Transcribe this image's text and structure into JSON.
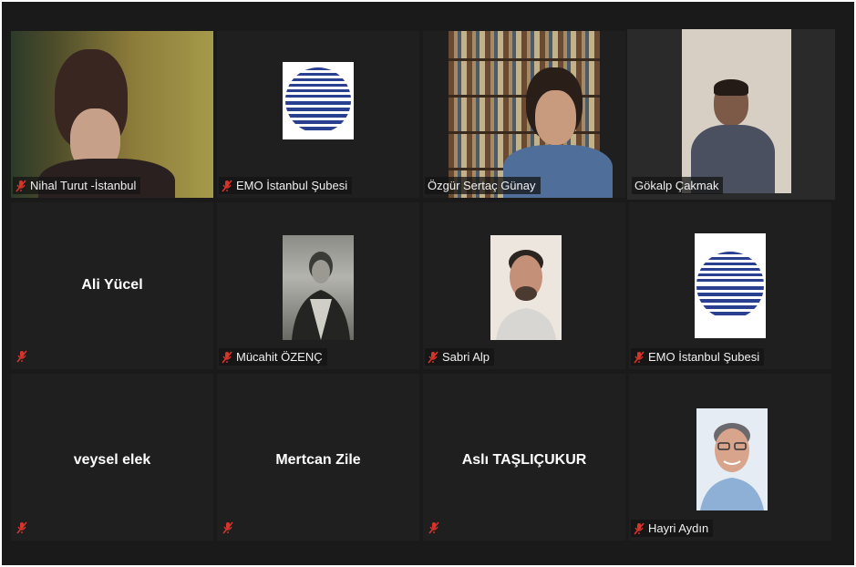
{
  "participants": [
    {
      "name": "Nihal Turut -İstanbul",
      "type": "video",
      "muted": true
    },
    {
      "name": "EMO İstanbul Şubesi",
      "type": "logo",
      "muted": true
    },
    {
      "name": "Özgür Sertaç Günay",
      "type": "video",
      "muted": false
    },
    {
      "name": "Gökalp Çakmak",
      "type": "video",
      "muted": false,
      "active_speaker": true
    },
    {
      "name": "Ali Yücel",
      "type": "name-only",
      "muted": true
    },
    {
      "name": "Mücahit ÖZENÇ",
      "type": "photo",
      "muted": true
    },
    {
      "name": "Sabri Alp",
      "type": "photo",
      "muted": true
    },
    {
      "name": "EMO İstanbul Şubesi",
      "type": "logo",
      "muted": true
    },
    {
      "name": "veysel elek",
      "type": "name-only",
      "muted": true
    },
    {
      "name": "Mertcan Zile",
      "type": "name-only",
      "muted": true
    },
    {
      "name": "Aslı TAŞLIÇUKUR",
      "type": "name-only",
      "muted": true
    },
    {
      "name": "Hayri Aydın",
      "type": "photo",
      "muted": true
    }
  ],
  "colors": {
    "background": "#1a1a1a",
    "tile": "#1f1f1f",
    "active_border": "#c9d25a",
    "mute_icon": "#d9342b",
    "logo_blue": "#2a3f8f"
  }
}
